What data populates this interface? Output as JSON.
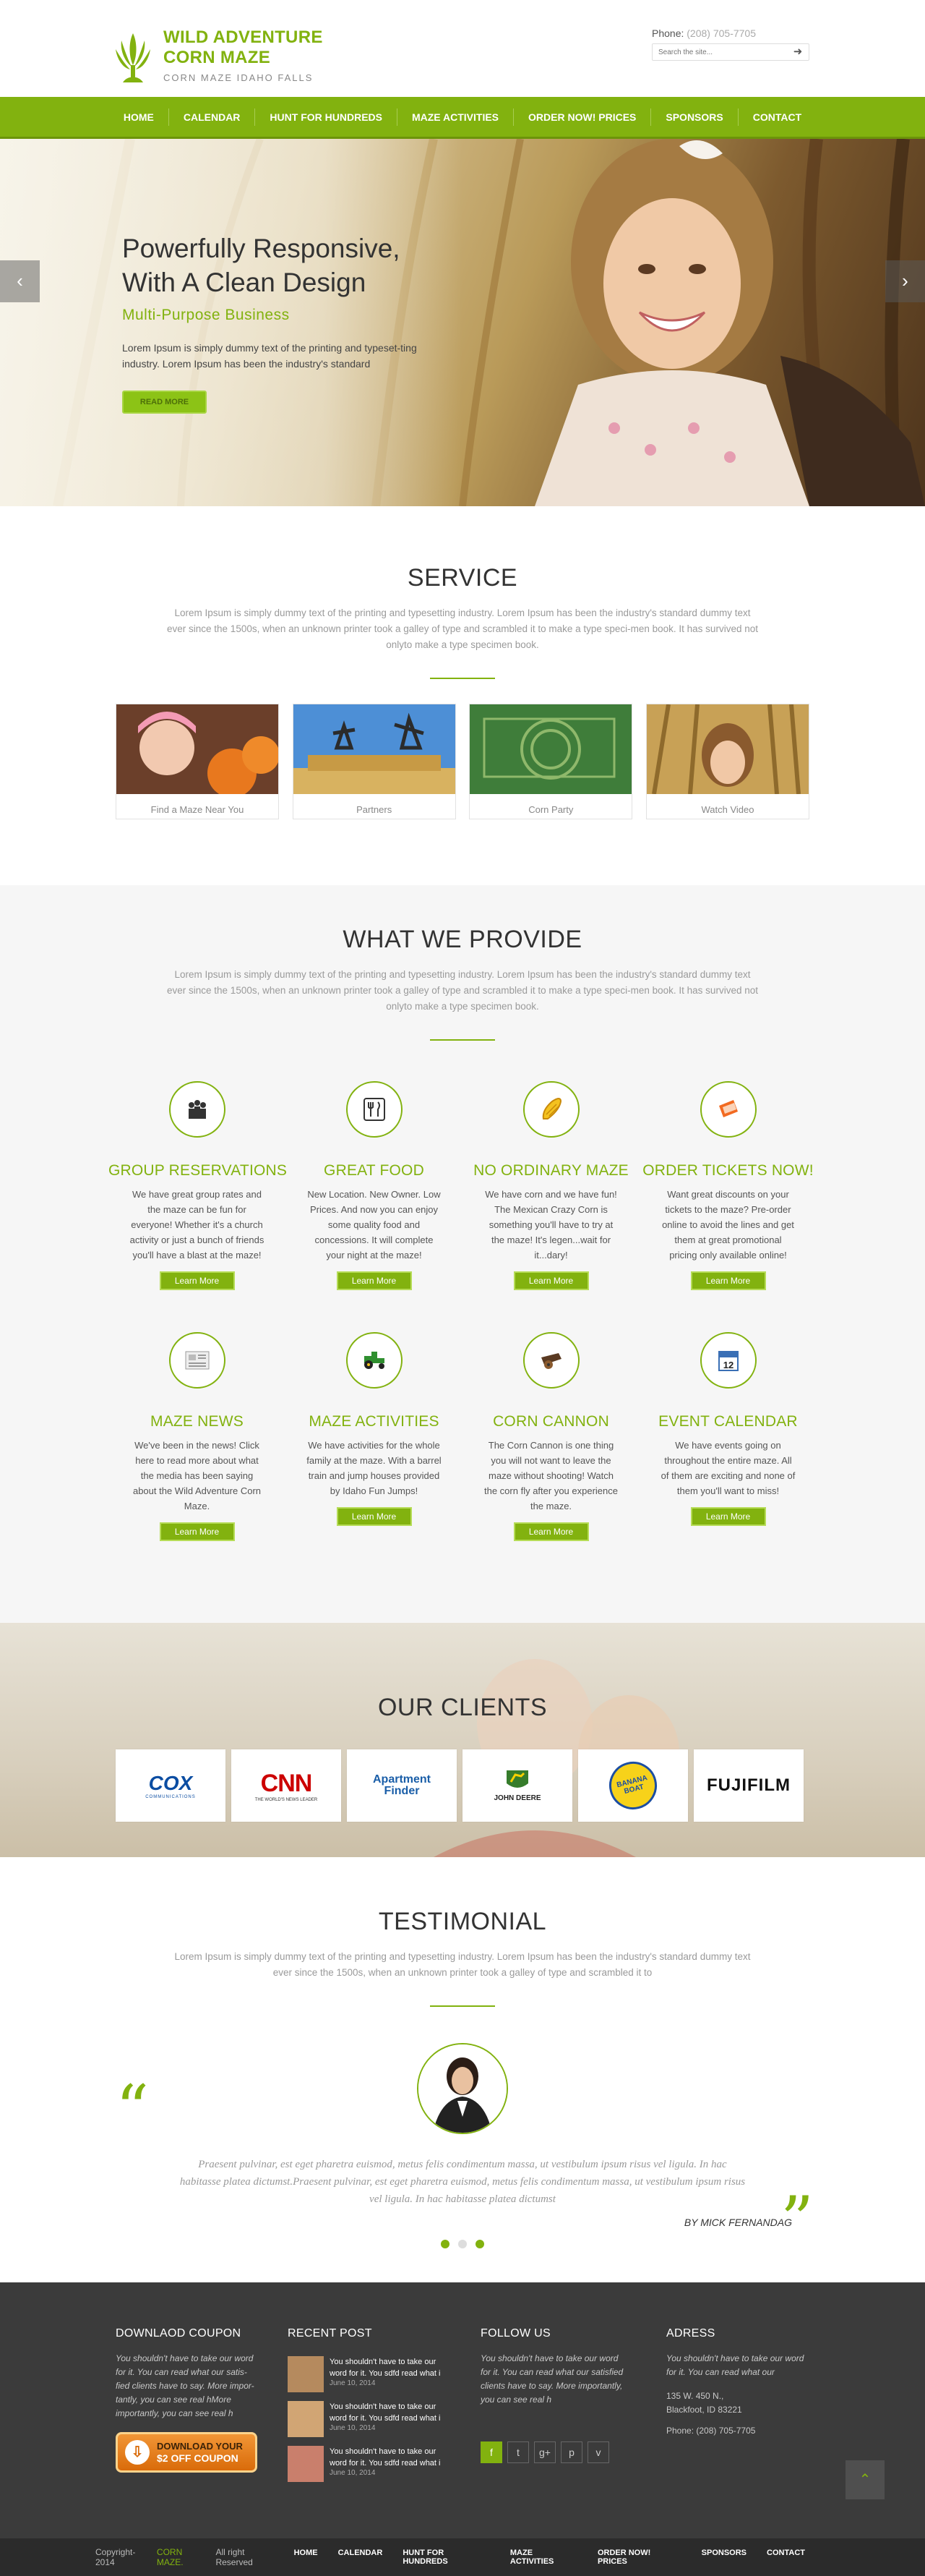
{
  "brand": {
    "title_line1": "WILD ADVENTURE",
    "title_line2": "CORN MAZE",
    "subtitle": "CORN MAZE IDAHO FALLS"
  },
  "header": {
    "phone_label": "Phone:",
    "phone_number": "(208) 705-7705",
    "search_placeholder": "Search the site..."
  },
  "nav": {
    "items": [
      "HOME",
      "CALENDAR",
      "HUNT FOR HUNDREDS",
      "MAZE ACTIVITIES",
      "ORDER NOW! PRICES",
      "SPONSORS",
      "CONTACT"
    ]
  },
  "hero": {
    "heading_line1": "Powerfully Responsive,",
    "heading_line2": "With A Clean Design",
    "subheading": "Multi-Purpose Business",
    "text": "Lorem Ipsum is simply dummy text of the printing and typeset-ting industry. Lorem Ipsum has been the industry's standard",
    "button": "READ MORE"
  },
  "service": {
    "title": "SERVICE",
    "intro": "Lorem Ipsum is simply dummy text of the printing and typesetting industry. Lorem Ipsum has been the industry's standard dummy text ever since the 1500s, when an unknown printer took a galley of type and scrambled it to make a type speci-men book. It has survived not onlyto make a type specimen book.",
    "cards": [
      "Find a Maze Near You",
      "Partners",
      "Corn Party",
      "Watch Video"
    ]
  },
  "provide": {
    "title": "WHAT WE PROVIDE",
    "intro": "Lorem Ipsum is simply dummy text of the printing and typesetting industry. Lorem Ipsum has been the industry's standard dummy text ever since the 1500s, when an unknown printer took a galley of type and scrambled it to make a type speci-men book. It has survived not onlyto make a type specimen book.",
    "button": "Learn More",
    "features": [
      {
        "title": "GROUP RESERVATIONS",
        "icon": "group-icon",
        "text": "We have great group rates and the maze can be fun for everyone! Whether it's a church activity or just a bunch of friends you'll have a blast at the maze!"
      },
      {
        "title": "GREAT FOOD",
        "icon": "food-icon",
        "text": "New Location. New Owner. Low Prices. And now you can enjoy some quality food and concessions. It will complete your night at the maze!"
      },
      {
        "title": "NO ORDINARY MAZE",
        "icon": "corn-icon",
        "text": "We have corn and we have fun! The Mexican Crazy Corn is something you'll have to try at the maze! It's legen...wait for it...dary!"
      },
      {
        "title": "ORDER TICKETS NOW!",
        "icon": "ticket-icon",
        "text": "Want great discounts on your tickets to the maze? Pre-order online to avoid the lines and get them at great promotional pricing only available online!"
      },
      {
        "title": "MAZE NEWS",
        "icon": "news-icon",
        "text": "We've been in the news! Click here to read more about what the media has been saying about the Wild Adventure Corn Maze."
      },
      {
        "title": "MAZE ACTIVITIES",
        "icon": "tractor-icon",
        "text": "We have activities for the whole family at the maze. With a barrel train and jump houses provided by Idaho Fun Jumps!"
      },
      {
        "title": "CORN CANNON",
        "icon": "cannon-icon",
        "text": "The Corn Cannon is one thing you will not want to leave the maze without shooting! Watch the corn fly after you experience the maze."
      },
      {
        "title": "EVENT CALENDAR",
        "icon": "calendar-icon",
        "text": "We have events going on throughout the entire maze. All of them are exciting and none of them you'll want to miss!"
      }
    ]
  },
  "clients": {
    "title": "OUR CLIENTS",
    "logos": [
      {
        "name": "COX",
        "sub": "COMMUNICATIONS"
      },
      {
        "name": "CNN",
        "sub": "THE WORLD'S NEWS LEADER"
      },
      {
        "name": "Apartment Finder",
        "sub": ""
      },
      {
        "name": "JOHN DEERE",
        "sub": ""
      },
      {
        "name": "BANANA BOAT",
        "sub": ""
      },
      {
        "name": "FUJIFILM",
        "sub": ""
      }
    ]
  },
  "testimonial": {
    "title": "TESTIMONIAL",
    "intro": "Lorem Ipsum is simply dummy text of the printing and typesetting industry. Lorem Ipsum has been the industry's standard dummy text ever since the 1500s, when an unknown printer took a galley of type and scrambled it to",
    "quote": "Praesent pulvinar, est eget pharetra euismod, metus felis condimentum massa, ut vestibulum ipsum risus vel ligula. In hac habitasse platea dictumst.Praesent pulvinar, est eget pharetra euismod, metus felis condimentum massa, ut vestibulum ipsum risus vel ligula. In hac habitasse platea dictumst",
    "author": "BY MICK FERNANDAG"
  },
  "footer": {
    "coupon": {
      "title": "DOWNLAOD COUPON",
      "text": "You shouldn't have to take our word for it. You can read what our satis-fied clients have to say. More impor-tantly, you can see real hMore importantly, you can see real h",
      "button_line1": "DOWNLOAD YOUR",
      "button_line2": "$2 OFF COUPON"
    },
    "recent": {
      "title": "RECENT POST",
      "posts": [
        {
          "text": "You shouldn't have to take our word for it. You sdfd read what i",
          "date": "June 10, 2014"
        },
        {
          "text": "You shouldn't have to take our word for it. You sdfd read what i",
          "date": "June 10, 2014"
        },
        {
          "text": "You shouldn't have to take our word for it. You sdfd read what i",
          "date": "June 10, 2014"
        }
      ]
    },
    "follow": {
      "title": "FOLLOW US",
      "text": "You shouldn't have to take our word for it. You can read what our satisfied clients have to say. More importantly, you can see real h",
      "icons": [
        "f",
        "t",
        "g+",
        "p",
        "v"
      ]
    },
    "address": {
      "title": "ADRESS",
      "text": "You shouldn't have to take our word for it. You can read what our",
      "line1": "135 W. 450 N.,",
      "line2": "Blackfoot, ID 83221",
      "phone": "Phone: (208) 705-7705"
    }
  },
  "bottom": {
    "copyright": "Copyright-2014",
    "brand": "CORN MAZE.",
    "rights": "All right Reserved",
    "links": [
      "HOME",
      "CALENDAR",
      "HUNT FOR HUNDREDS",
      "MAZE ACTIVITIES",
      "ORDER NOW! PRICES",
      "SPONSORS",
      "CONTACT"
    ]
  },
  "colors": {
    "accent": "#82b20f",
    "footer_bg": "#3b3b3b",
    "bottom_bg": "#2b2b2b"
  }
}
